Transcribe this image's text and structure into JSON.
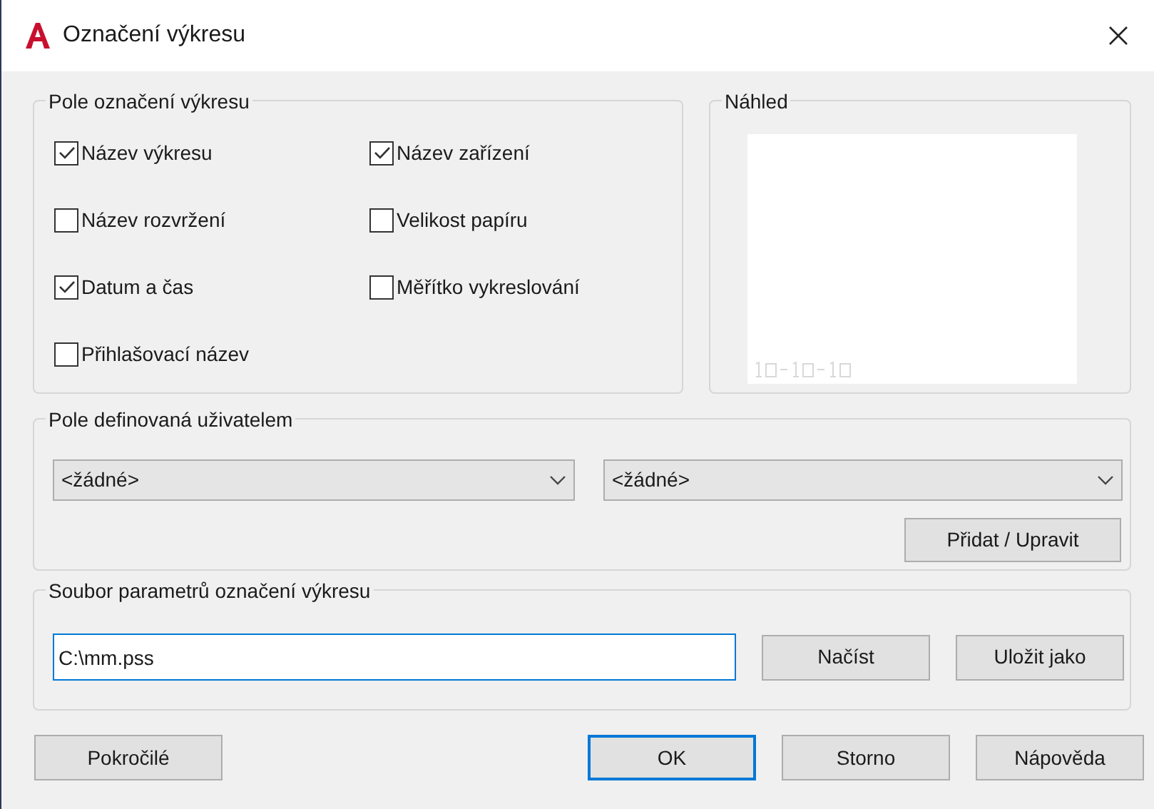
{
  "window": {
    "title": "Označení výkresu"
  },
  "fields_group": {
    "title": "Pole označení výkresu",
    "columns": [
      [
        {
          "label": "Název výkresu",
          "checked": true
        },
        {
          "label": "Název rozvržení",
          "checked": false
        },
        {
          "label": "Datum a čas",
          "checked": true
        },
        {
          "label": "Přihlašovací název",
          "checked": false
        }
      ],
      [
        {
          "label": "Název zařízení",
          "checked": true
        },
        {
          "label": "Velikost papíru",
          "checked": false
        },
        {
          "label": "Měřítko vykreslování",
          "checked": false
        }
      ]
    ]
  },
  "preview": {
    "title": "Náhled"
  },
  "user_fields": {
    "title": "Pole definovaná uživatelem",
    "dropdowns": [
      "<žádné>",
      "<žádné>"
    ],
    "button": "Přidat / Upravit"
  },
  "parameter_file": {
    "title": "Soubor parametrů označení výkresu",
    "value": "C:\\mm.pss",
    "buttons": [
      "Načíst",
      "Uložit jako"
    ]
  },
  "footer": {
    "left_button": "Pokročilé",
    "buttons": [
      {
        "label": "OK",
        "default": true
      },
      {
        "label": "Storno",
        "default": false
      },
      {
        "label": "Nápověda",
        "default": false
      }
    ]
  }
}
